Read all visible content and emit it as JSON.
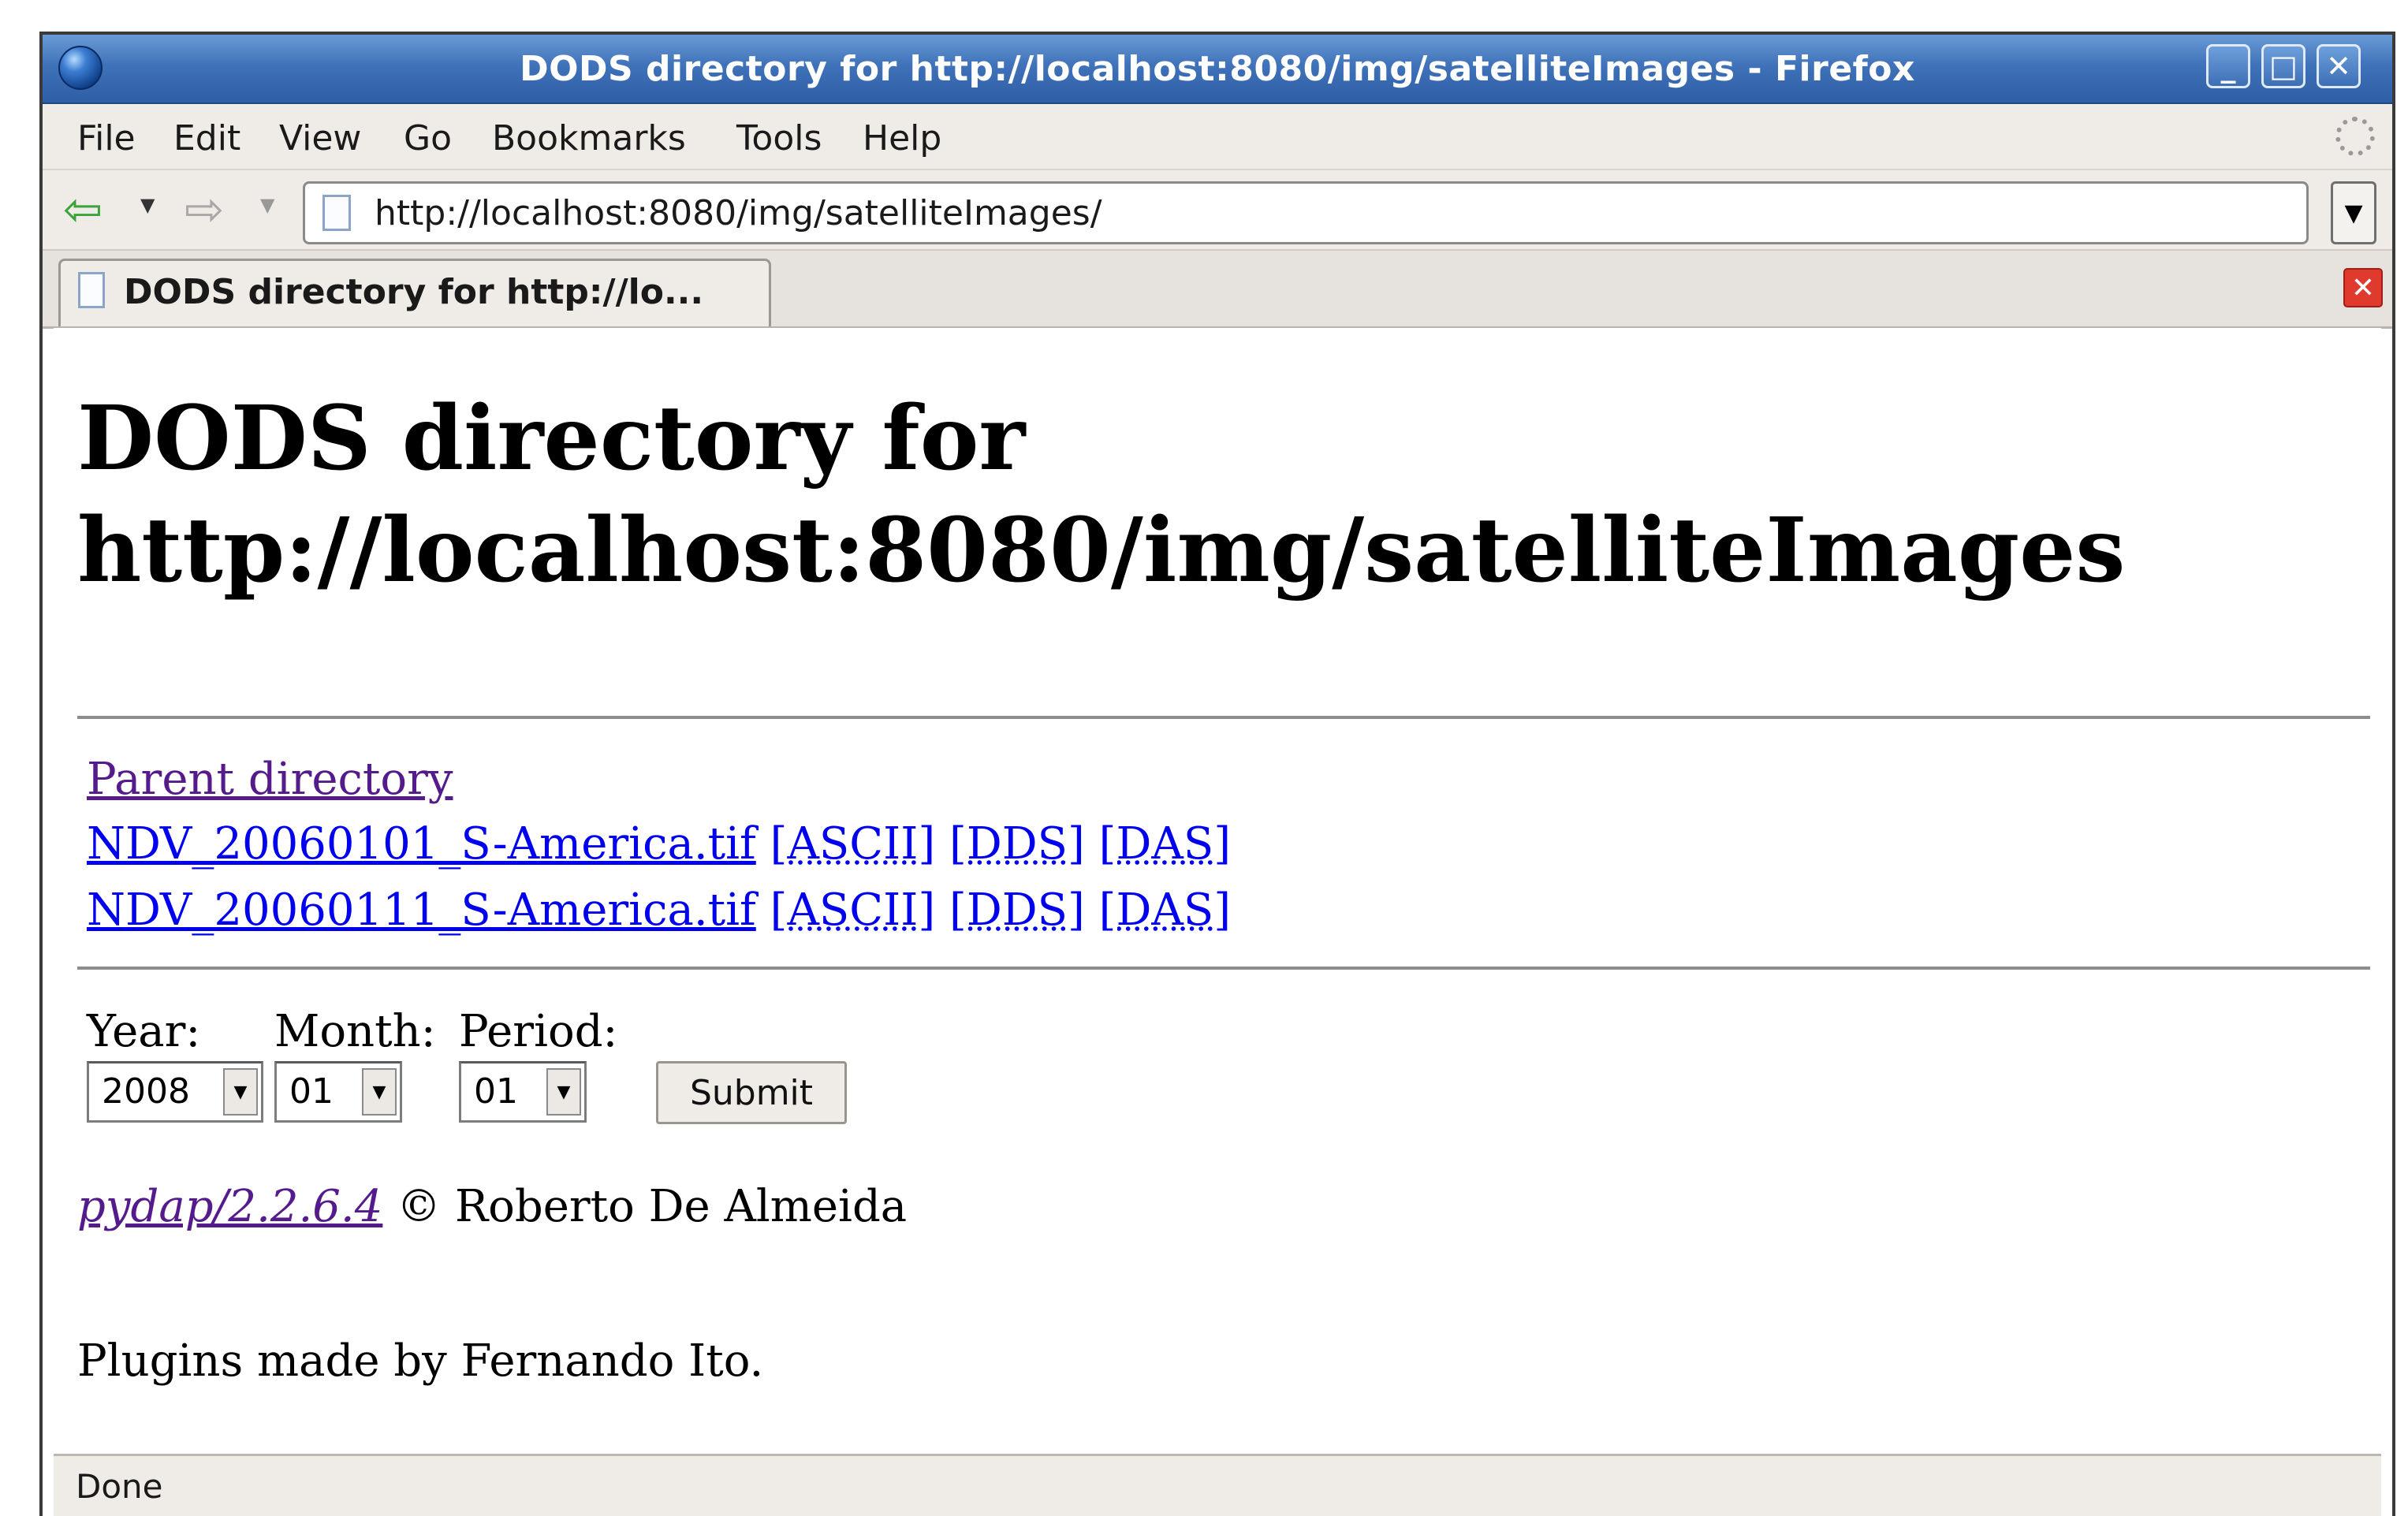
{
  "window": {
    "title": "DODS directory for http://localhost:8080/img/satelliteImages - Firefox"
  },
  "menu": [
    "File",
    "Edit",
    "View",
    "Go",
    "Bookmarks",
    "Tools",
    "Help"
  ],
  "address": {
    "url": "http://localhost:8080/img/satelliteImages/"
  },
  "tab": {
    "label": "DODS directory for http://lo..."
  },
  "page": {
    "heading_line1": "DODS directory for",
    "heading_line2": "http://localhost:8080/img/satelliteImages",
    "parent_link": "Parent directory",
    "files": [
      {
        "name": "NDV_20060101_S-America.tif",
        "ascii": "[ASCII]",
        "dds": "[DDS]",
        "das": "[DAS]"
      },
      {
        "name": "NDV_20060111_S-America.tif",
        "ascii": "[ASCII]",
        "dds": "[DDS]",
        "das": "[DAS]"
      }
    ],
    "form": {
      "year_label": "Year:",
      "month_label": "Month:",
      "period_label": "Period:",
      "year_value": "2008",
      "month_value": "01",
      "period_value": "01",
      "submit_label": "Submit"
    },
    "pydap_link": "pydap/2.2.6.4",
    "copyright": " © Roberto De Almeida",
    "plugins_note": "Plugins made by Fernando Ito."
  },
  "status": {
    "text": "Done"
  },
  "colors": {
    "titlebar": "#3f72b9",
    "link": "#0000ee",
    "visited_link": "#551a8b",
    "chrome": "#efebe7"
  },
  "icons": {
    "app": "firefox-globe-icon",
    "back": "back-arrow-icon",
    "forward": "forward-arrow-icon",
    "page": "page-icon",
    "close_tab": "close-icon",
    "throbber": "throbber-icon"
  }
}
